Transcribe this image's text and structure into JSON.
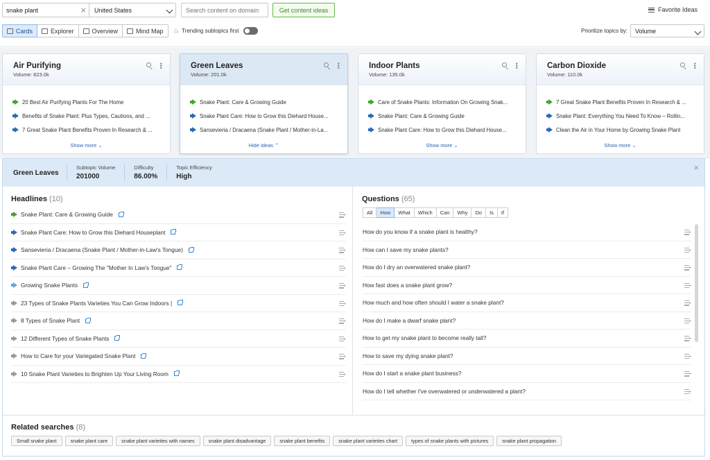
{
  "toolbar": {
    "keyword": "snake plant",
    "country": "United States",
    "domain_placeholder": "Search content on domain",
    "get_ideas": "Get content ideas",
    "favorite_ideas": "Favorite Ideas",
    "view_tabs": [
      "Cards",
      "Explorer",
      "Overview",
      "Mind Map"
    ],
    "active_tab": "Cards",
    "trending_label": "Trending subtopics first",
    "trending_on": false,
    "prioritize_label": "Prioritize topics by:",
    "prioritize_value": "Volume"
  },
  "cards": [
    {
      "title": "Air Purifying",
      "volume": "Volume: 823.0k",
      "items": [
        {
          "text": "20 Best Air Purifying Plants For The Home",
          "icon": "megaphone-green"
        },
        {
          "text": "Benefits of Snake Plant: Plus Types, Cautions, and ...",
          "icon": "megaphone-blue"
        },
        {
          "text": "7 Great Snake Plant Benefits Proven In Research & ...",
          "icon": "megaphone-blue"
        }
      ],
      "toggle": "Show more"
    },
    {
      "title": "Green Leaves",
      "volume": "Volume: 201.0k",
      "items": [
        {
          "text": "Snake Plant: Care & Growing Guide",
          "icon": "megaphone-green"
        },
        {
          "text": "Snake Plant Care: How to Grow this Diehard House...",
          "icon": "megaphone-blue"
        },
        {
          "text": "Sansevieria / Dracaena (Snake Plant / Mother-in-La...",
          "icon": "megaphone-blue"
        }
      ],
      "toggle": "Hide ideas"
    },
    {
      "title": "Indoor Plants",
      "volume": "Volume: 135.0k",
      "items": [
        {
          "text": "Care of Snake Plants: Information On Growing Snak...",
          "icon": "megaphone-green"
        },
        {
          "text": "Snake Plant: Care & Growing Guide",
          "icon": "megaphone-blue"
        },
        {
          "text": "Snake Plant Care: How to Grow this Diehard House...",
          "icon": "megaphone-blue"
        }
      ],
      "toggle": "Show more"
    },
    {
      "title": "Carbon Dioxide",
      "volume": "Volume: 110.0k",
      "items": [
        {
          "text": "7 Great Snake Plant Benefits Proven In Research & ...",
          "icon": "megaphone-green"
        },
        {
          "text": "Snake Plant: Everything You Need To Know – Rollin...",
          "icon": "megaphone-blue"
        },
        {
          "text": "Clean the Air in Your Home by Growing Snake Plant",
          "icon": "megaphone-blue"
        }
      ],
      "toggle": "Show more"
    }
  ],
  "detail": {
    "title": "Green Leaves",
    "stats": [
      {
        "label": "Subtopic Volume",
        "value": "201000"
      },
      {
        "label": "Difficulty",
        "value": "86.00%"
      },
      {
        "label": "Topic Efficiency",
        "value": "High"
      }
    ],
    "headlines_title": "Headlines",
    "headlines_count": "(10)",
    "headlines": [
      {
        "text": "Snake Plant: Care & Growing Guide",
        "icon": "megaphone-green"
      },
      {
        "text": "Snake Plant Care: How to Grow this Diehard Houseplant",
        "icon": "megaphone-blue"
      },
      {
        "text": "Sansevieria / Dracaena (Snake Plant / Mother-in-Law's Tongue)",
        "icon": "megaphone-blue"
      },
      {
        "text": "Snake Plant Care – Growing The \"Mother In Law's Tongue\"",
        "icon": "megaphone-blue"
      },
      {
        "text": "Growing Snake Plants",
        "icon": "megaphone-lightblue"
      },
      {
        "text": "23 Types of Snake Plants Varieties You Can Grow Indoors |",
        "icon": "megaphone-gray"
      },
      {
        "text": "8 Types of Snake Plant",
        "icon": "megaphone-gray"
      },
      {
        "text": "12 Different Types of Snake Plants",
        "icon": "megaphone-gray"
      },
      {
        "text": "How to Care for your Variegated Snake Plant",
        "icon": "megaphone-gray"
      },
      {
        "text": "10 Snake Plant Varieties to Brighten Up Your Living Room",
        "icon": "megaphone-gray"
      }
    ],
    "questions_title": "Questions",
    "questions_count": "(65)",
    "question_filters": [
      "All",
      "How",
      "What",
      "Which",
      "Can",
      "Why",
      "Do",
      "Is",
      "If"
    ],
    "active_filter": "How",
    "questions": [
      "How do you know if a snake plant is healthy?",
      "How can I save my snake plants?",
      "How do I dry an overwatered snake plant?",
      "How fast does a snake plant grow?",
      "How much and how often should I water a snake plant?",
      "How do I make a dwarf snake plant?",
      "How to get my snake plant to become really tall?",
      "How to save my dying snake plant?",
      "How do I start a snake plant business?",
      "How do I tell whether I've overwatered or underwatered a plant?"
    ],
    "related_title": "Related searches",
    "related_count": "(8)",
    "related": [
      "Small snake plant",
      "snake plant care",
      "snake plant varieties with names",
      "snake plant disadvantage",
      "snake plant benefits",
      "snake plant varieties chart",
      "types of snake plants with pictures",
      "snake plant propagation"
    ]
  }
}
